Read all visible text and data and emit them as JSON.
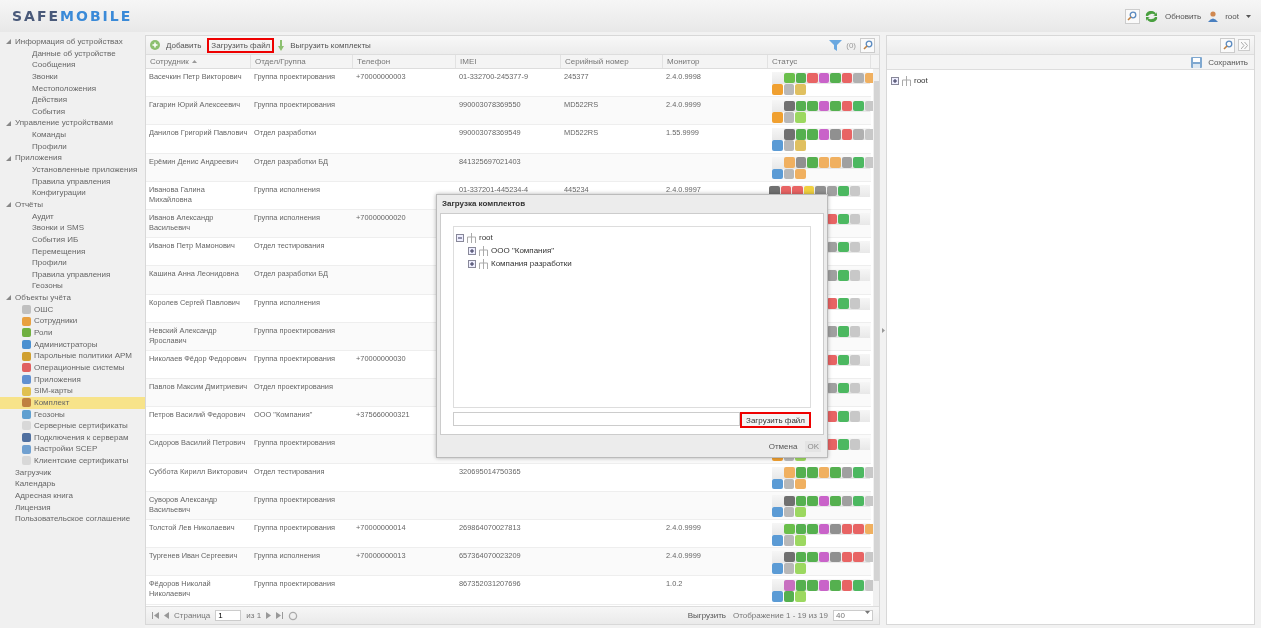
{
  "header": {
    "logo_left": "SAFE",
    "logo_right": "MOBILE",
    "refresh": "Обновить",
    "user": "root"
  },
  "sidebar": {
    "items": [
      {
        "label": "Информация об устройствах",
        "expanded": true,
        "selected": false,
        "children": [
          {
            "label": "Данные об устройстве",
            "selected": false
          },
          {
            "label": "Сообщения",
            "selected": false
          },
          {
            "label": "Звонки",
            "selected": false
          },
          {
            "label": "Местоположения",
            "selected": false
          },
          {
            "label": "Действия",
            "selected": false
          },
          {
            "label": "События",
            "selected": false
          }
        ]
      },
      {
        "label": "Управление устройствами",
        "expanded": true,
        "selected": false,
        "children": [
          {
            "label": "Команды",
            "selected": false
          },
          {
            "label": "Профили",
            "selected": false
          }
        ]
      },
      {
        "label": "Приложения",
        "expanded": true,
        "selected": false,
        "children": [
          {
            "label": "Установленные приложения",
            "selected": false
          },
          {
            "label": "Правила управления",
            "selected": false
          },
          {
            "label": "Конфигурации",
            "selected": false
          }
        ]
      },
      {
        "label": "Отчёты",
        "expanded": true,
        "selected": false,
        "children": [
          {
            "label": "Аудит",
            "selected": false
          },
          {
            "label": "Звонки и SMS",
            "selected": false
          },
          {
            "label": "События ИБ",
            "selected": false
          },
          {
            "label": "Перемещения",
            "selected": false
          },
          {
            "label": "Профили",
            "selected": false
          },
          {
            "label": "Правила управления",
            "selected": false
          },
          {
            "label": "Геозоны",
            "selected": false
          }
        ]
      },
      {
        "label": "Объекты учёта",
        "expanded": true,
        "selected": false,
        "children": [
          {
            "label": "ОШС",
            "selected": false,
            "kind": "org"
          },
          {
            "label": "Сотрудники",
            "selected": false,
            "kind": "person"
          },
          {
            "label": "Роли",
            "selected": false,
            "kind": "roles"
          },
          {
            "label": "Администраторы",
            "selected": false,
            "kind": "admin"
          },
          {
            "label": "Парольные политики АРМ",
            "selected": false,
            "kind": "password"
          },
          {
            "label": "Операционные системы",
            "selected": false,
            "kind": "os"
          },
          {
            "label": "Приложения",
            "selected": false,
            "kind": "window"
          },
          {
            "label": "SIM-карты",
            "selected": false,
            "kind": "sim"
          },
          {
            "label": "Комплект",
            "selected": true,
            "kind": "kit"
          },
          {
            "label": "Геозоны",
            "selected": false,
            "kind": "map"
          },
          {
            "label": "Серверные сертификаты",
            "selected": false,
            "kind": "doc"
          },
          {
            "label": "Подключения к серверам",
            "selected": false,
            "kind": "server"
          },
          {
            "label": "Настройки SCEP",
            "selected": false,
            "kind": "chart"
          },
          {
            "label": "Клиентские сертификаты",
            "selected": false,
            "kind": "doc"
          }
        ]
      },
      {
        "label": "Загрузчик",
        "selected": false
      },
      {
        "label": "Календарь",
        "selected": false
      },
      {
        "label": "Адресная книга",
        "selected": false
      },
      {
        "label": "Лицензия",
        "selected": false
      },
      {
        "label": "Пользовательское соглашение",
        "selected": false
      }
    ]
  },
  "toolbar": {
    "add": "Добавить",
    "upload": "Загрузить файл",
    "export": "Выгрузить комплекты",
    "filter_count": "(0)"
  },
  "table": {
    "columns": [
      "Сотрудник",
      "Отдел/Группа",
      "Телефон",
      "IMEI",
      "Серийный номер",
      "Монитор",
      "Статус"
    ],
    "rows": [
      {
        "employee": "Васечкин Петр Викторович",
        "group": "Группа проектирования",
        "phone": "+70000000003",
        "imei": "01-332700-245377-9",
        "serial": "245377",
        "monitor": "2.4.0.9998",
        "status_top": [
          {
            "color": "#6abf4b"
          },
          {
            "color": "#55b04f"
          },
          {
            "color": "#e86464"
          },
          {
            "color": "#c963c9"
          },
          {
            "color": "#55b04f"
          },
          {
            "color": "#e86464"
          },
          {
            "color": "#b0b0b0"
          },
          {
            "color": "#f0b060"
          }
        ],
        "status_bottom": [
          {
            "color": "#f0a030"
          },
          {
            "color": "#b8b8b8"
          },
          {
            "color": "#e0c060"
          }
        ]
      },
      {
        "employee": "Гагарин Юрий Алексеевич",
        "group": "Группа проектирования",
        "imei": "990003078369550",
        "serial": "MD522RS",
        "monitor": "2.4.0.9999",
        "status_top": [
          {
            "color": "#707070"
          },
          {
            "color": "#55b04f"
          },
          {
            "color": "#55b04f"
          },
          {
            "color": "#c963c9"
          },
          {
            "color": "#55b04f"
          },
          {
            "color": "#e86464"
          },
          {
            "color": "#4cb860"
          },
          {
            "color": "#c8c8c8"
          }
        ],
        "status_bottom": [
          {
            "color": "#f0a030"
          },
          {
            "color": "#b8b8b8"
          },
          {
            "color": "#9cd860"
          }
        ]
      },
      {
        "employee": "Данилов Григорий Павлович",
        "group": "Отдел разработки",
        "imei": "990003078369549",
        "serial": "MD522RS",
        "monitor": "1.55.9999",
        "status_top": [
          {
            "color": "#707070"
          },
          {
            "color": "#55b04f"
          },
          {
            "color": "#55b04f"
          },
          {
            "color": "#c963c9"
          },
          {
            "color": "#909090"
          },
          {
            "color": "#e86464"
          },
          {
            "color": "#b0b0b0"
          },
          {
            "color": "#c8c8c8"
          }
        ],
        "status_bottom": [
          {
            "color": "#5b9bd5"
          },
          {
            "color": "#b8b8b8"
          },
          {
            "color": "#e0c060"
          }
        ]
      },
      {
        "employee": "Ерёмин Денис Андреевич",
        "group": "Отдел разработки БД",
        "imei": "841325697021403",
        "status_top": [
          {
            "color": "#f0b060"
          },
          {
            "color": "#909090"
          },
          {
            "color": "#55b04f"
          },
          {
            "color": "#f0b060"
          },
          {
            "color": "#f0b060"
          },
          {
            "color": "#a0a0a0"
          },
          {
            "color": "#4cb860"
          },
          {
            "color": "#c8c8c8"
          }
        ],
        "status_bottom": [
          {
            "color": "#5b9bd5"
          },
          {
            "color": "#b8b8b8"
          },
          {
            "color": "#f0b060"
          }
        ]
      },
      {
        "employee": "Иванова Галина Михайловна",
        "group": "Группа исполнения",
        "imei": "01-337201-445234-4",
        "serial": "445234",
        "monitor": "2.4.0.9997",
        "status_top": [
          {
            "color": "#707070"
          },
          {
            "color": "#e86464"
          },
          {
            "color": "#e86464"
          },
          {
            "color": "#f0d040"
          },
          {
            "color": "#909090"
          },
          {
            "color": "#a0a0a0"
          },
          {
            "color": "#4cb860"
          },
          {
            "color": "#c8c8c8"
          }
        ]
      },
      {
        "employee": "Иванов Александр Васильевич",
        "group": "Группа исполнения",
        "phone": "+70000000020",
        "status_top": [
          {
            "color": "#e86464"
          },
          {
            "color": "#4cb860"
          },
          {
            "color": "#c8c8c8"
          }
        ]
      },
      {
        "employee": "Иванов Петр Мамонович",
        "group": "Отдел тестирования",
        "status_top": [
          {
            "color": "#a0a0a0"
          },
          {
            "color": "#4cb860"
          },
          {
            "color": "#c8c8c8"
          }
        ]
      },
      {
        "employee": "Кашина Анна Леонидовна",
        "group": "Отдел разработки БД",
        "status_top": [
          {
            "color": "#a0a0a0"
          },
          {
            "color": "#4cb860"
          },
          {
            "color": "#c8c8c8"
          }
        ]
      },
      {
        "employee": "Королев Сергей Павлович",
        "group": "Группа исполнения",
        "status_top": [
          {
            "color": "#e86464"
          },
          {
            "color": "#4cb860"
          },
          {
            "color": "#c8c8c8"
          }
        ]
      },
      {
        "employee": "Невский Александр Ярославич",
        "group": "Группа проектирования",
        "status_top": [
          {
            "color": "#a0a0a0"
          },
          {
            "color": "#4cb860"
          },
          {
            "color": "#c8c8c8"
          }
        ]
      },
      {
        "employee": "Николаев Фёдор Федорович",
        "group": "Группа проектирования",
        "phone": "+70000000030",
        "status_top": [
          {
            "color": "#e86464"
          },
          {
            "color": "#4cb860"
          },
          {
            "color": "#c8c8c8"
          }
        ]
      },
      {
        "employee": "Павлов Максим Дмитриевич",
        "group": "Отдел проектирования",
        "status_top": [
          {
            "color": "#a0a0a0"
          },
          {
            "color": "#4cb860"
          },
          {
            "color": "#c8c8c8"
          }
        ]
      },
      {
        "employee": "Петров Василий Федорович",
        "group": "ООО \"Компания\"",
        "phone": "+375660000321",
        "status_top": [
          {
            "color": "#e86464"
          },
          {
            "color": "#4cb860"
          },
          {
            "color": "#c8c8c8"
          }
        ]
      },
      {
        "employee": "Сидоров Василий Петрович",
        "group": "Группа проектирования",
        "status_top": [
          {
            "color": "#e86464"
          },
          {
            "color": "#4cb860"
          },
          {
            "color": "#c8c8c8"
          }
        ],
        "status_bottom": [
          {
            "color": "#f0a030"
          },
          {
            "color": "#b8b8b8"
          },
          {
            "color": "#9cd860"
          }
        ]
      },
      {
        "employee": "Суббота Кирилл Викторович",
        "group": "Отдел тестирования",
        "imei": "320695014750365",
        "status_top": [
          {
            "color": "#f0b060"
          },
          {
            "color": "#55b04f"
          },
          {
            "color": "#55b04f"
          },
          {
            "color": "#f0b060"
          },
          {
            "color": "#55b04f"
          },
          {
            "color": "#a0a0a0"
          },
          {
            "color": "#4cb860"
          },
          {
            "color": "#c8c8c8"
          }
        ],
        "status_bottom": [
          {
            "color": "#5b9bd5"
          },
          {
            "color": "#b8b8b8"
          },
          {
            "color": "#f0b060"
          }
        ]
      },
      {
        "employee": "Суворов Александр Васильевич",
        "group": "Группа проектирования",
        "status_top": [
          {
            "color": "#707070"
          },
          {
            "color": "#55b04f"
          },
          {
            "color": "#55b04f"
          },
          {
            "color": "#c963c9"
          },
          {
            "color": "#55b04f"
          },
          {
            "color": "#a0a0a0"
          },
          {
            "color": "#4cb860"
          },
          {
            "color": "#c8c8c8"
          }
        ],
        "status_bottom": [
          {
            "color": "#5b9bd5"
          },
          {
            "color": "#b8b8b8"
          },
          {
            "color": "#9cd860"
          }
        ]
      },
      {
        "employee": "Толстой Лев Николаевич",
        "group": "Группа проектирования",
        "phone": "+70000000014",
        "imei": "269864070027813",
        "monitor": "2.4.0.9999",
        "status_top": [
          {
            "color": "#6abf4b"
          },
          {
            "color": "#55b04f"
          },
          {
            "color": "#55b04f"
          },
          {
            "color": "#c963c9"
          },
          {
            "color": "#909090"
          },
          {
            "color": "#e86464"
          },
          {
            "color": "#e86464"
          },
          {
            "color": "#f0b060"
          }
        ],
        "status_bottom": [
          {
            "color": "#5b9bd5"
          },
          {
            "color": "#b8b8b8"
          },
          {
            "color": "#9cd860"
          }
        ]
      },
      {
        "employee": "Тургенев Иван Сергеевич",
        "group": "Группа исполнения",
        "phone": "+70000000013",
        "imei": "657364070023209",
        "monitor": "2.4.0.9999",
        "status_top": [
          {
            "color": "#707070"
          },
          {
            "color": "#55b04f"
          },
          {
            "color": "#55b04f"
          },
          {
            "color": "#c963c9"
          },
          {
            "color": "#909090"
          },
          {
            "color": "#e86464"
          },
          {
            "color": "#e86464"
          },
          {
            "color": "#c8c8c8"
          }
        ],
        "status_bottom": [
          {
            "color": "#5b9bd5"
          },
          {
            "color": "#b8b8b8"
          },
          {
            "color": "#9cd860"
          }
        ]
      },
      {
        "employee": "Фёдоров Николай Николаевич",
        "group": "Группа проектирования",
        "imei": "867352031207696",
        "monitor": "1.0.2",
        "status_top": [
          {
            "color": "#c870c0"
          },
          {
            "color": "#55b04f"
          },
          {
            "color": "#55b04f"
          },
          {
            "color": "#c963c9"
          },
          {
            "color": "#55b04f"
          },
          {
            "color": "#e86464"
          },
          {
            "color": "#4cb860"
          },
          {
            "color": "#c8c8c8"
          }
        ],
        "status_bottom": [
          {
            "color": "#5b9bd5"
          },
          {
            "color": "#55b04f"
          },
          {
            "color": "#9cd860"
          }
        ]
      }
    ]
  },
  "pager": {
    "page_label": "Страница",
    "page": "1",
    "of": "из 1",
    "export": "Выгрузить",
    "display": "Отображение 1 - 19 из 19",
    "page_size": "40"
  },
  "dialog": {
    "title": "Загрузка комплектов",
    "tree": [
      {
        "label": "root",
        "expanded": true,
        "children": [
          {
            "label": "ООО \"Компания\"",
            "expanded": false
          },
          {
            "label": "Компания разработки",
            "expanded": false
          }
        ]
      }
    ],
    "upload": "Загрузить файл",
    "cancel": "Отмена",
    "ok": "OK",
    "ok_disabled": true
  },
  "right_panel": {
    "save": "Сохранить",
    "tree": [
      {
        "label": "root",
        "expanded": false
      }
    ]
  }
}
